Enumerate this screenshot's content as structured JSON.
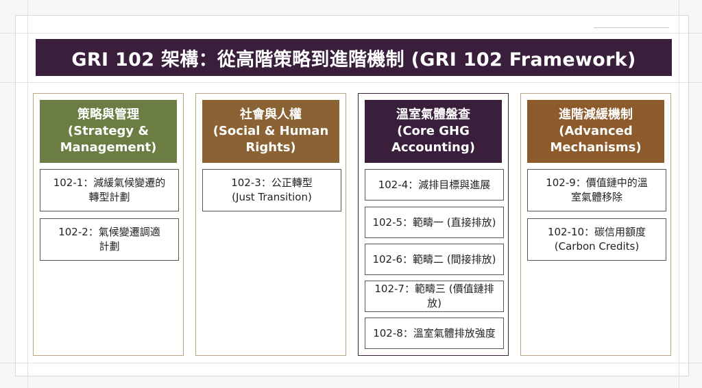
{
  "title": "GRI 102 架構：從高階策略到進階機制 (GRI 102 Framework)",
  "colors": {
    "title_bg": "#3a1f3d",
    "strategy": "#6b7d43",
    "social": "#8a6233",
    "ghg": "#3a1f3d",
    "advanced": "#8c5a2b"
  },
  "columns": [
    {
      "header_zh": "策略與管理",
      "header_en_1": "(Strategy &",
      "header_en_2": "Management)",
      "items": [
        {
          "line1": "102-1：減緩氣候變遷的",
          "line2": "轉型計劃"
        },
        {
          "line1": "102-2：氣候變遷調適",
          "line2": "計劃"
        }
      ]
    },
    {
      "header_zh": "社會與人權",
      "header_en_1": "(Social & Human",
      "header_en_2": "Rights)",
      "items": [
        {
          "line1": "102-3：公正轉型",
          "line2": "(Just Transition)"
        }
      ]
    },
    {
      "header_zh": "溫室氣體盤查",
      "header_en_1": "(Core GHG",
      "header_en_2": "Accounting)",
      "items": [
        {
          "line1": "102-4：減排目標與進展"
        },
        {
          "line1": "102-5：範疇一 (直接排放)"
        },
        {
          "line1": "102-6：範疇二 (間接排放)"
        },
        {
          "line1": "102-7：範疇三 (價值鏈排放)"
        },
        {
          "line1": "102-8：溫室氣體排放強度"
        }
      ]
    },
    {
      "header_zh": "進階減緩機制",
      "header_en_1": "(Advanced",
      "header_en_2": "Mechanisms)",
      "items": [
        {
          "line1": "102-9：價值鏈中的溫",
          "line2": "室氣體移除"
        },
        {
          "line1": "102-10：碳信用額度",
          "line2": "(Carbon Credits)"
        }
      ]
    }
  ]
}
